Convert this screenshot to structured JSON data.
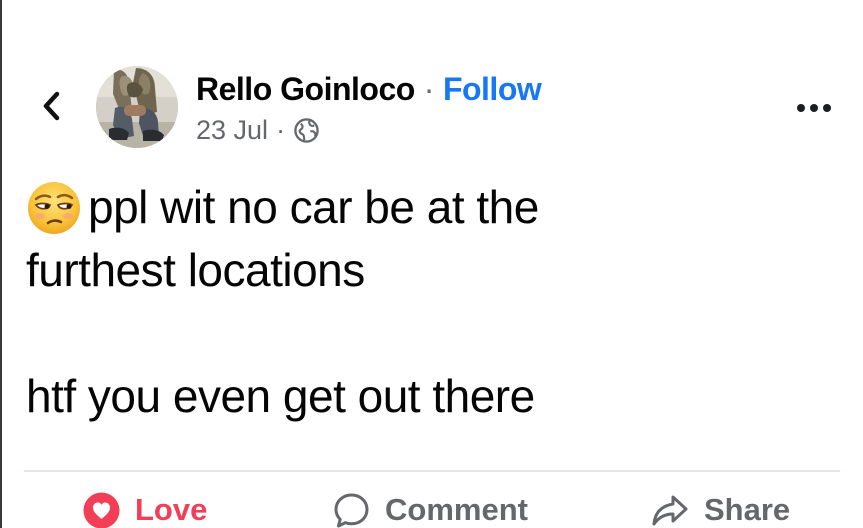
{
  "post": {
    "author": "Rello Goinloco",
    "separator": "·",
    "follow_label": "Follow",
    "date": "23 Jul",
    "audience_icon": "globe-icon",
    "body_lines": [
      "ppl wit no car be at the",
      "furthest locations",
      "",
      "htf you even get out there"
    ],
    "emoji_icon": "unamused-face-emoji"
  },
  "actions": {
    "love_label": "Love",
    "comment_label": "Comment",
    "share_label": "Share"
  },
  "icons": {
    "back": "chevron-left-icon",
    "more": "more-options-icon",
    "love": "heart-icon",
    "comment": "speech-bubble-icon",
    "share": "share-arrow-icon"
  },
  "colors": {
    "follow_link": "#1877f2",
    "love_reaction": "#f33e58",
    "secondary_text": "#65676b",
    "primary_text": "#050505"
  }
}
